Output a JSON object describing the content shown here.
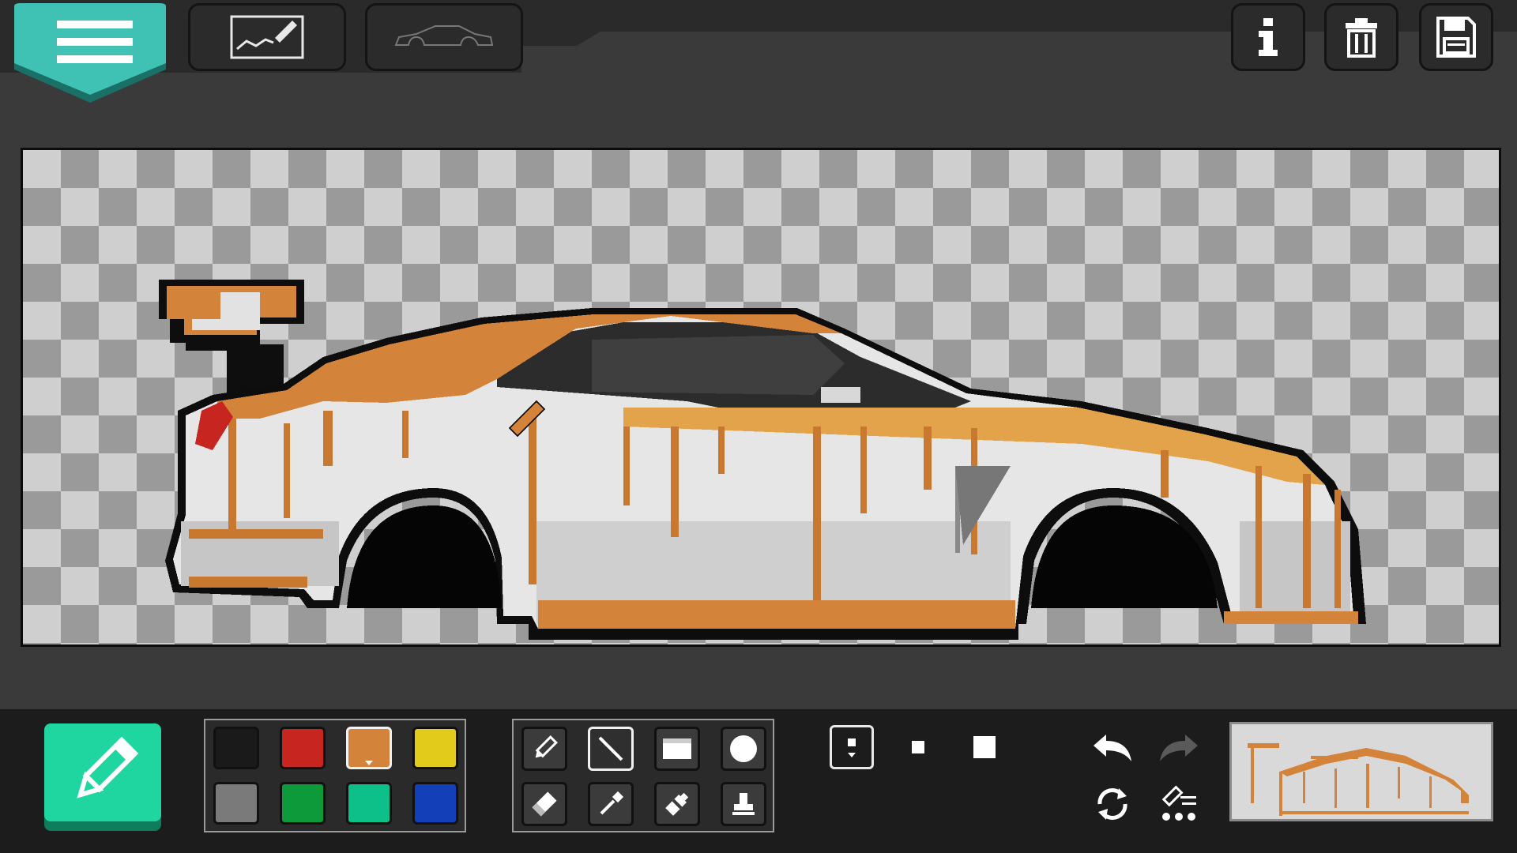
{
  "header": {
    "menu_button": "hamburger-icon",
    "tabs": [
      {
        "icon": "draw-on-canvas-icon"
      },
      {
        "icon": "car-outline-icon"
      }
    ],
    "actions": [
      {
        "icon": "info-icon"
      },
      {
        "icon": "trash-icon"
      },
      {
        "icon": "save-floppy-icon"
      }
    ]
  },
  "canvas": {
    "background": "transparency-checkerboard",
    "content": "pixel-art-car-livery"
  },
  "active_tool_button": {
    "icon": "pencil-icon",
    "color": "#1fd6a0"
  },
  "palette": {
    "colors": [
      "#1a1a1a",
      "#c6261f",
      "#d4843a",
      "#e2cb1b",
      "#7a7a7a",
      "#0c9a3a",
      "#0dc08a",
      "#1340b8"
    ],
    "selected_index": 2
  },
  "tools": [
    {
      "icon": "pencil-icon",
      "selected": false
    },
    {
      "icon": "line-icon",
      "selected": true
    },
    {
      "icon": "rectangle-icon",
      "selected": false
    },
    {
      "icon": "circle-icon",
      "selected": false
    },
    {
      "icon": "eraser-icon",
      "selected": false
    },
    {
      "icon": "eyedropper-icon",
      "selected": false
    },
    {
      "icon": "paint-bucket-icon",
      "selected": false
    },
    {
      "icon": "stamp-icon",
      "selected": false
    }
  ],
  "brush_sizes": {
    "options": [
      "small",
      "medium",
      "large"
    ],
    "selected": "small"
  },
  "history": {
    "undo_icon": "undo-icon",
    "redo_icon": "redo-icon",
    "redo_enabled": false,
    "flip_icon": "rotate-icon",
    "layers_icon": "pencil-dots-icon"
  },
  "preview": {
    "content": "livery-thumbnail"
  }
}
